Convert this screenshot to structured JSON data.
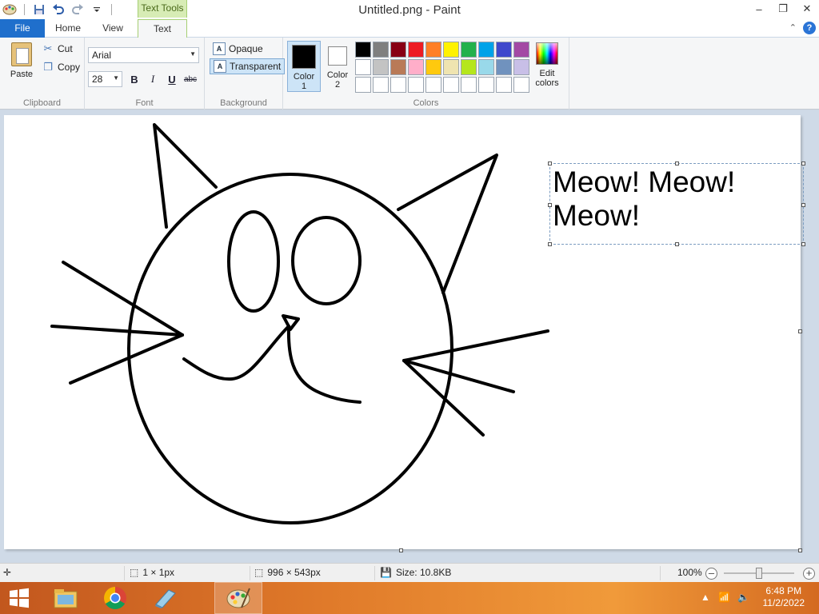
{
  "window": {
    "title": "Untitled.png - Paint",
    "contextual_tab": "Text Tools",
    "controls": {
      "minimize": "–",
      "maximize": "❐",
      "close": "✕"
    }
  },
  "tabs": {
    "file": "File",
    "home": "Home",
    "view": "View",
    "text": "Text",
    "help": "?"
  },
  "ribbon": {
    "clipboard": {
      "label": "Clipboard",
      "paste": "Paste",
      "cut": "Cut",
      "copy": "Copy"
    },
    "font": {
      "label": "Font",
      "family": "Arial",
      "size": "28",
      "bold": "B",
      "italic": "I",
      "underline": "U",
      "strike": "abc"
    },
    "background": {
      "label": "Background",
      "opaque": "Opaque",
      "transparent": "Transparent",
      "selected": "transparent"
    },
    "colors": {
      "label": "Colors",
      "color1_label": "Color",
      "color1_num": "1",
      "color2_label": "Color",
      "color2_num": "2",
      "color1": "#000000",
      "color2": "#ffffff",
      "edit_label": "Edit",
      "edit_label2": "colors",
      "palette": [
        "#000000",
        "#7f7f7f",
        "#880015",
        "#ed1c24",
        "#ff7f27",
        "#fff200",
        "#22b14c",
        "#00a2e8",
        "#3f48cc",
        "#a349a4",
        "#ffffff",
        "#c3c3c3",
        "#b97a57",
        "#ffaec9",
        "#ffc90e",
        "#efe4b0",
        "#b5e61d",
        "#99d9ea",
        "#7092be",
        "#c8bfe7",
        "#ffffff",
        "#ffffff",
        "#ffffff",
        "#ffffff",
        "#ffffff",
        "#ffffff",
        "#ffffff",
        "#ffffff",
        "#ffffff",
        "#ffffff"
      ]
    }
  },
  "canvas": {
    "text_line1": "Meow! Meow!",
    "text_line2": "Meow!"
  },
  "status": {
    "selection": "1 × 1px",
    "dimensions": "996 × 543px",
    "size": "Size: 10.8KB",
    "zoom": "100%",
    "zoom_level": 1.0
  },
  "taskbar": {
    "time": "6:48 PM",
    "date": "11/2/2022"
  }
}
